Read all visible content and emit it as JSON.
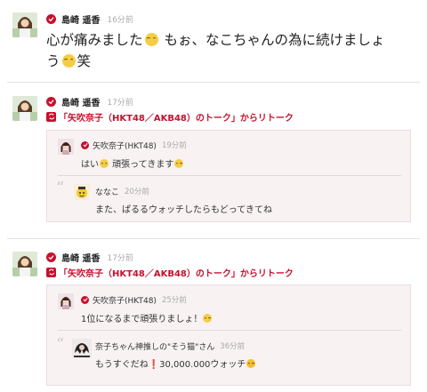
{
  "posts": [
    {
      "author": "島崎 遥香",
      "time": "16分前",
      "text_a": "心が痛みました",
      "text_b": " もぉ、なこちゃんの為に続けましょ",
      "text_c": "う",
      "text_d": "笑"
    },
    {
      "author": "島崎 遥香",
      "time": "17分前",
      "retalk_label": "「矢吹奈子（HKT48／AKB48）のトーク」からリトーク",
      "quote": {
        "author": "矢吹奈子(HKT48)",
        "time": "19分前",
        "text_a": "はい",
        "text_b": " 頑張ってきます",
        "reply": {
          "author": "ななこ",
          "time": "20分前",
          "text": "また、ぱるるウォッチしたらもどってきてね"
        }
      }
    },
    {
      "author": "島崎 遥香",
      "time": "17分前",
      "retalk_label": "「矢吹奈子（HKT48／AKB48）のトーク」からリトーク",
      "quote": {
        "author": "矢吹奈子(HKT48)",
        "time": "25分前",
        "text_a": "1位になるまで頑張りましょ！",
        "reply": {
          "author": "奈子ちゃん神推しの\"そう猫\"さん",
          "time": "36分前",
          "text_a": "もうすぐだね",
          "exclaim": "❗",
          "text_b": "30,000.000ウォッチ"
        }
      }
    }
  ],
  "colors": {
    "accent": "#c8102e",
    "quote_bg": "#f8f2f3",
    "divider": "#e2e2e2"
  },
  "icons": {
    "verified": "verified-badge-icon",
    "retalk": "retalk-icon",
    "quote": "quote-mark-icon",
    "emoji": "smiley-emoji-icon"
  }
}
